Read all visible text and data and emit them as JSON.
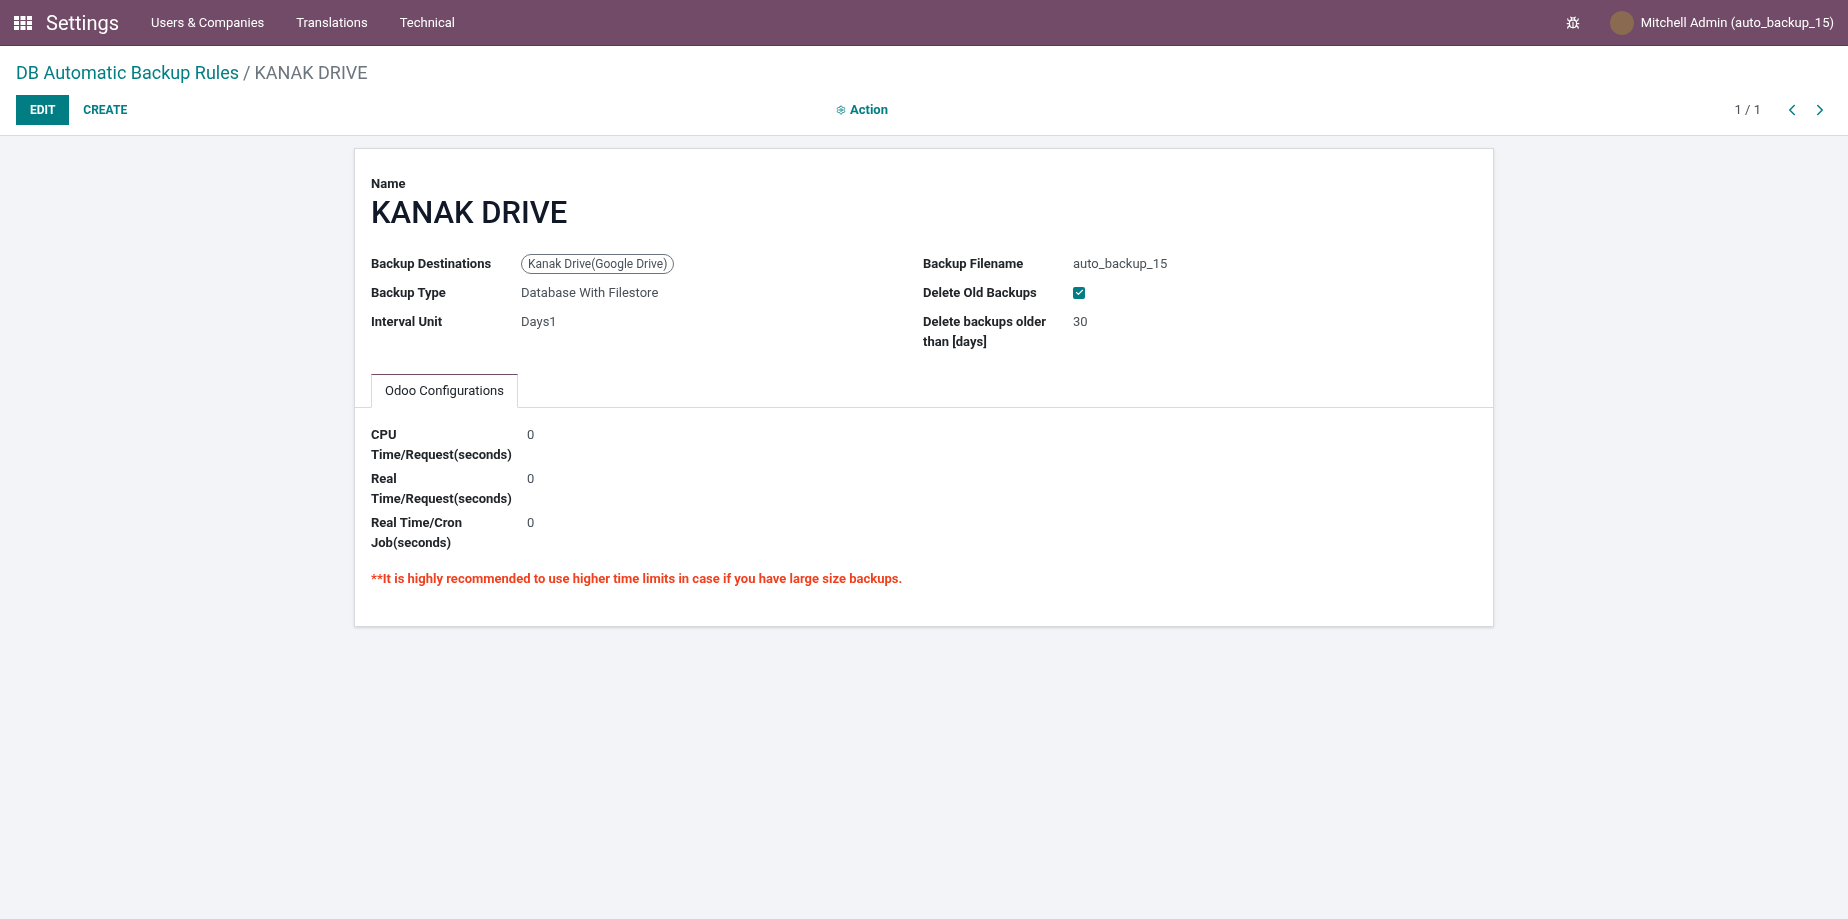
{
  "navbar": {
    "app_name": "Settings",
    "menu": [
      {
        "label": "Users & Companies"
      },
      {
        "label": "Translations"
      },
      {
        "label": "Technical"
      }
    ],
    "user": "Mitchell Admin (auto_backup_15)"
  },
  "breadcrumb": {
    "parent": "DB Automatic Backup Rules",
    "separator": "/",
    "current": "KANAK DRIVE"
  },
  "toolbar": {
    "buttons": [
      {
        "label": "EDIT",
        "kind": "primary"
      },
      {
        "label": "CREATE",
        "kind": "link"
      }
    ],
    "action": "Action",
    "pager": "1 / 1"
  },
  "form": {
    "name_label": "Name",
    "name": "KANAK DRIVE",
    "left_fields": [
      {
        "label": "Backup Destinations",
        "kind": "tag",
        "value": "Kanak Drive(Google Drive)"
      },
      {
        "label": "Backup Type",
        "kind": "text",
        "value": "Database With Filestore"
      },
      {
        "label": "Interval Unit",
        "kind": "text",
        "value": "Days1"
      }
    ],
    "right_fields": [
      {
        "label": "Backup Filename",
        "kind": "text",
        "value": "auto_backup_15"
      },
      {
        "label": "Delete Old Backups",
        "kind": "checkbox",
        "checked": true
      },
      {
        "label": "Delete backups older than [days]",
        "kind": "text",
        "value": "30"
      }
    ],
    "tabs": [
      {
        "label": "Odoo Configurations",
        "selected": true
      }
    ],
    "config_fields": [
      {
        "label": "CPU Time/Request(seconds)",
        "value": "0"
      },
      {
        "label": "Real Time/Request(seconds)",
        "value": "0"
      },
      {
        "label": "Real Time/Cron Job(seconds)",
        "value": "0"
      }
    ],
    "warning": "**It is highly recommended to use higher time limits in case if you have large size backups."
  }
}
